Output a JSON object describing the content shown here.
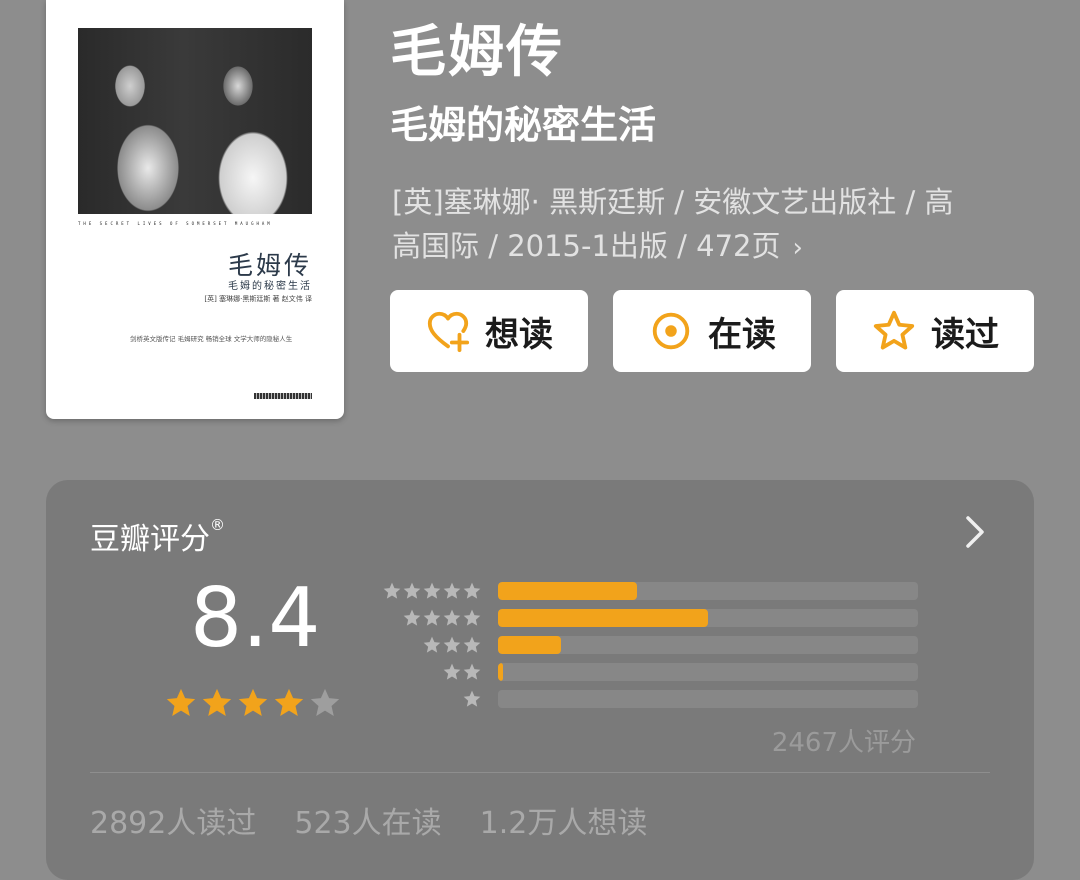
{
  "book": {
    "title": "毛姆传",
    "subtitle": "毛姆的秘密生活",
    "meta_line1": "[英]塞琳娜· 黑斯廷斯 / 安徽文艺出版社 / 高",
    "meta_line2": "高国际 / 2015-1出版 / 472页",
    "meta_chevron": "›"
  },
  "cover": {
    "strip_text": "THE SECRET LIVES OF SOMERSET MAUGHAM",
    "title": "毛姆传",
    "subtitle": "毛姆的秘密生活",
    "author_line": "[英] 塞琳娜·黑斯廷斯 著 赵文伟 译",
    "blurb": "剑桥英文版传记 毛姆研究 畅销全球 文学大师的隐秘人生"
  },
  "actions": [
    {
      "label": "想读",
      "icon": "heart-plus-icon"
    },
    {
      "label": "在读",
      "icon": "target-circle-icon"
    },
    {
      "label": "读过",
      "icon": "star-outline-icon"
    }
  ],
  "rating": {
    "header": "豆瓣评分",
    "registered_mark": "®",
    "score": "8.4",
    "stars_filled": 4,
    "stars_total": 5,
    "distribution": [
      {
        "stars": 5,
        "fraction": 0.33
      },
      {
        "stars": 4,
        "fraction": 0.5
      },
      {
        "stars": 3,
        "fraction": 0.15
      },
      {
        "stars": 2,
        "fraction": 0.01
      },
      {
        "stars": 1,
        "fraction": 0.0
      }
    ],
    "raters_text": "2467人评分"
  },
  "stats": {
    "read": "2892人读过",
    "reading": "523人在读",
    "want": "1.2万人想读"
  },
  "colors": {
    "accent": "#f2a31b",
    "background": "#8d8d8d",
    "card": "#7a7a7a",
    "track": "#878787"
  }
}
